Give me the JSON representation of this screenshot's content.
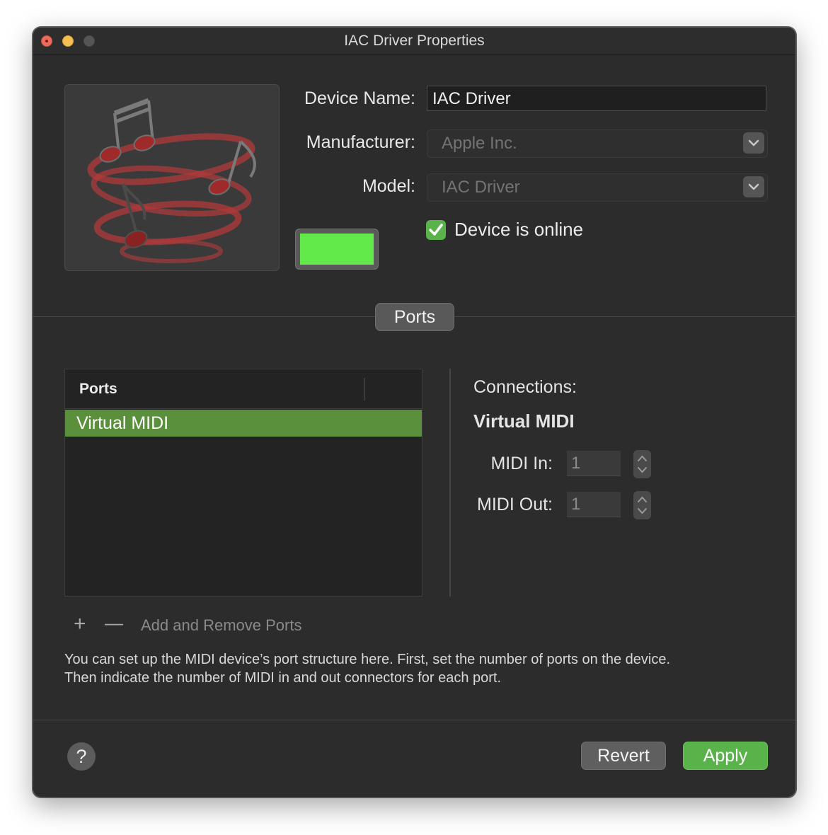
{
  "window": {
    "title": "IAC Driver Properties"
  },
  "device": {
    "name_label": "Device Name:",
    "name_value": "IAC Driver",
    "manufacturer_label": "Manufacturer:",
    "manufacturer_value": "Apple Inc.",
    "model_label": "Model:",
    "model_value": "IAC Driver",
    "online_label": "Device is online",
    "online_checked": true,
    "icon": "music-notes-icon",
    "color": "#62e94a"
  },
  "tabs": {
    "ports_label": "Ports"
  },
  "ports_table": {
    "column_header": "Ports",
    "rows": [
      "Virtual MIDI"
    ],
    "selected_index": 0
  },
  "connections": {
    "heading": "Connections:",
    "port_name": "Virtual MIDI",
    "midi_in_label": "MIDI In:",
    "midi_in_value": "1",
    "midi_out_label": "MIDI Out:",
    "midi_out_value": "1"
  },
  "port_controls": {
    "add_symbol": "+",
    "remove_symbol": "—",
    "label": "Add and Remove Ports"
  },
  "help_text": {
    "line1": "You can set up the MIDI device’s port structure here. First, set the number of ports on the device.",
    "line2": "Then indicate the number of MIDI in and out connectors for each port."
  },
  "footer": {
    "help_symbol": "?",
    "revert_label": "Revert",
    "apply_label": "Apply"
  },
  "colors": {
    "accent_green": "#5ab34a",
    "selection_green": "#5a8f3c",
    "window_bg": "#2c2c2c"
  }
}
